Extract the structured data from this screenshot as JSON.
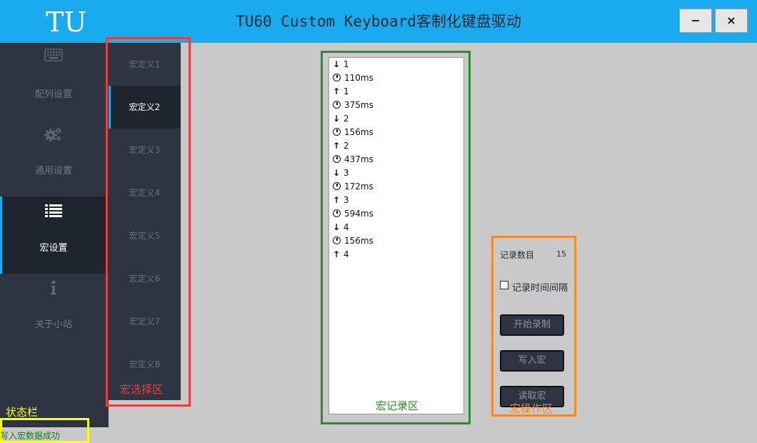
{
  "app": {
    "logo": "TU",
    "title": "TU60 Custom Keyboard客制化键盘驱动",
    "minimize_label": "−",
    "close_label": "×"
  },
  "nav": {
    "items": [
      {
        "label": "配列设置",
        "icon": "keyboard-icon",
        "active": false
      },
      {
        "label": "通用设置",
        "icon": "gears-icon",
        "active": false
      },
      {
        "label": "宏设置",
        "icon": "list-icon",
        "active": true
      },
      {
        "label": "关于小站",
        "icon": "info-icon",
        "active": false
      }
    ]
  },
  "macros": {
    "items": [
      "宏定义1",
      "宏定义2",
      "宏定义3",
      "宏定义4",
      "宏定义5",
      "宏定义6",
      "宏定义7",
      "宏定义8"
    ],
    "selected": "宏定义2"
  },
  "records": [
    {
      "type": "down",
      "text": "1"
    },
    {
      "type": "delay",
      "text": "110ms"
    },
    {
      "type": "up",
      "text": "1"
    },
    {
      "type": "delay",
      "text": "375ms"
    },
    {
      "type": "down",
      "text": "2"
    },
    {
      "type": "delay",
      "text": "156ms"
    },
    {
      "type": "up",
      "text": "2"
    },
    {
      "type": "delay",
      "text": "437ms"
    },
    {
      "type": "down",
      "text": "3"
    },
    {
      "type": "delay",
      "text": "172ms"
    },
    {
      "type": "up",
      "text": "3"
    },
    {
      "type": "delay",
      "text": "594ms"
    },
    {
      "type": "down",
      "text": "4"
    },
    {
      "type": "delay",
      "text": "156ms"
    },
    {
      "type": "up",
      "text": "4"
    }
  ],
  "ops": {
    "count_label": "记录数目",
    "count_value": "15",
    "interval_label": "记录时间间隔",
    "interval_checked": false,
    "start_record": "开始录制",
    "write_macro": "写入宏",
    "read_macro": "读取宏"
  },
  "annotations": {
    "macro_select": "宏选择区",
    "macro_record": "宏记录区",
    "macro_ops": "宏操作区",
    "status_bar": "状态栏"
  },
  "status": {
    "message": "写入宏数据成功"
  },
  "colors": {
    "title_bar": "#1aaaee",
    "nav_bg": "#2c3441",
    "nav_active": "#1f252e",
    "select_frame": "#e8413c",
    "record_frame": "#2e8b2e",
    "ops_frame": "#f08a30",
    "status_frame": "#ffff00"
  }
}
